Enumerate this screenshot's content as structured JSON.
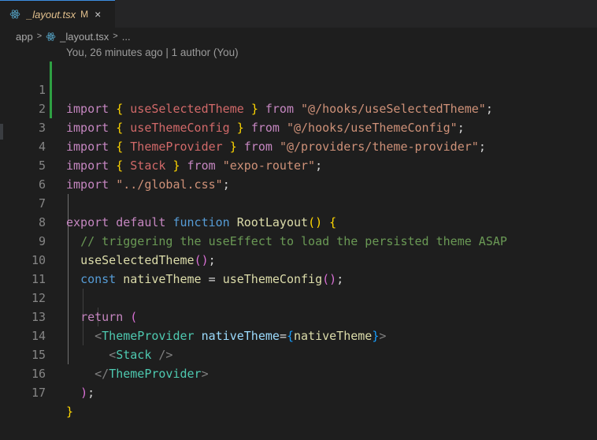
{
  "tab": {
    "file_name": "_layout.tsx",
    "modified_flag": "M",
    "close_glyph": "×"
  },
  "breadcrumb": {
    "folder": "app",
    "file": "_layout.tsx",
    "more": "..."
  },
  "blame": "You, 26 minutes ago | 1 author (You)",
  "lines": [
    {
      "n": "1"
    },
    {
      "n": "2"
    },
    {
      "n": "3"
    },
    {
      "n": "4"
    },
    {
      "n": "5"
    },
    {
      "n": "6"
    },
    {
      "n": "7"
    },
    {
      "n": "8"
    },
    {
      "n": "9"
    },
    {
      "n": "10"
    },
    {
      "n": "11"
    },
    {
      "n": "12"
    },
    {
      "n": "13"
    },
    {
      "n": "14"
    },
    {
      "n": "15"
    },
    {
      "n": "16"
    },
    {
      "n": "17"
    }
  ],
  "code": {
    "kw_import": "import",
    "kw_from": "from",
    "kw_export": "export",
    "kw_default": "default",
    "kw_function": "function",
    "kw_const": "const",
    "kw_return": "return",
    "id_useSelectedTheme": "useSelectedTheme",
    "id_useThemeConfig": "useThemeConfig",
    "id_ThemeProvider": "ThemeProvider",
    "id_Stack": "Stack",
    "id_RootLayout": "RootLayout",
    "id_nativeTheme": "nativeTheme",
    "str_hook1": "\"@/hooks/useSelectedTheme\"",
    "str_hook2": "\"@/hooks/useThemeConfig\"",
    "str_provider": "\"@/providers/theme-provider\"",
    "str_router": "\"expo-router\"",
    "str_css": "\"../global.css\"",
    "comment": "// triggering the useEffect to load the persisted theme ASAP"
  },
  "colors": {
    "accent": "#3c8de0",
    "modified": "#e2c08d",
    "added_gutter": "#2ea043"
  },
  "icons": {
    "tab": "react-icon",
    "breadcrumb_file": "react-icon",
    "close": "close-icon"
  }
}
